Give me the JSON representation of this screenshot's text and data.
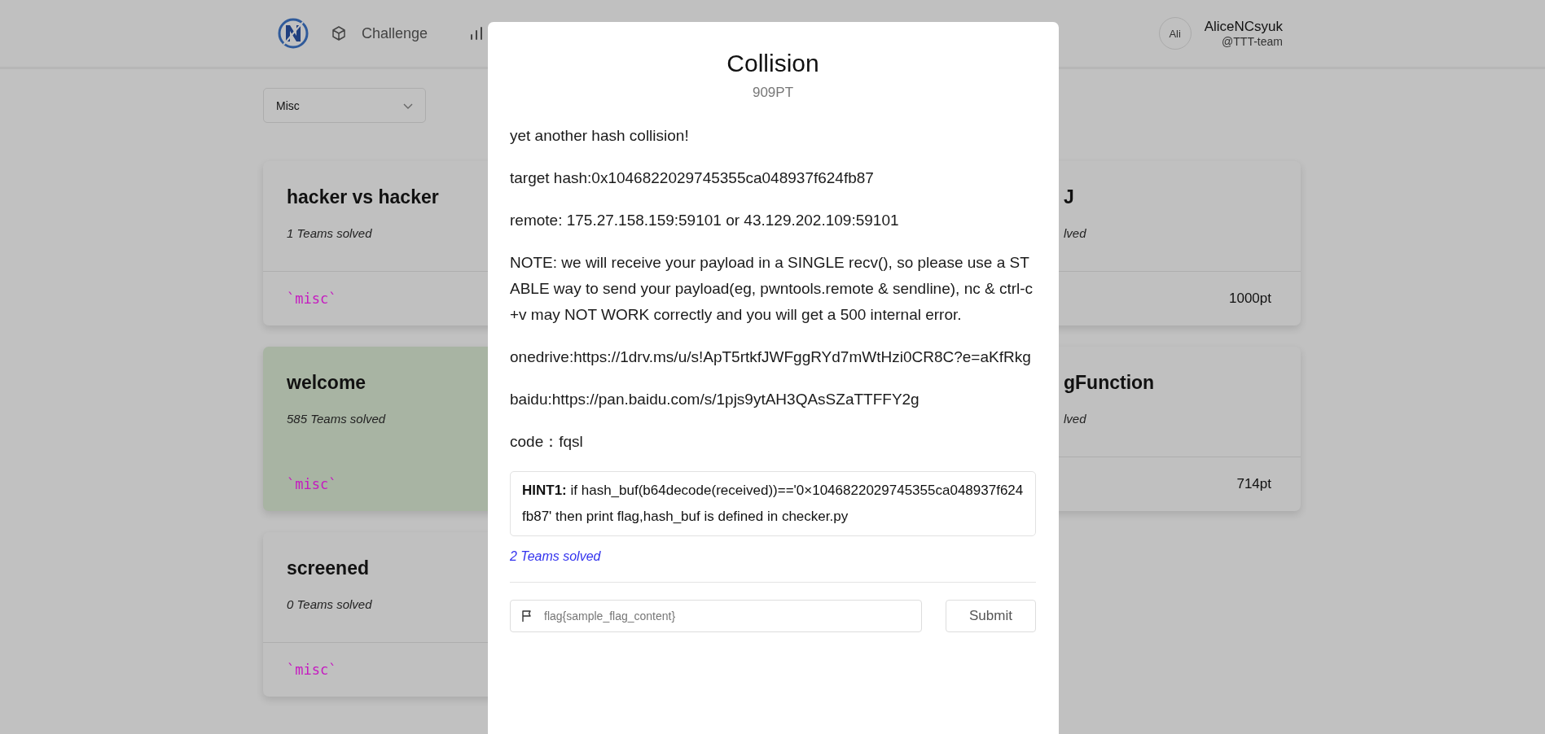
{
  "header": {
    "nav_items": [
      {
        "kind": "cube",
        "label": "Challenge"
      },
      {
        "kind": "bars"
      }
    ],
    "user": {
      "avatar": "Ali",
      "name": "AliceNCsyuk",
      "team": "@TTT-team"
    }
  },
  "category_filter": {
    "value": "Misc"
  },
  "cards_left": [
    {
      "title": "hacker vs hacker",
      "solved_text": "1 Teams solved",
      "tag": "`misc`",
      "solved": false
    },
    {
      "title": "welcome",
      "solved_text": "585 Teams solved",
      "tag": "`misc`",
      "solved": true
    },
    {
      "title": "screened",
      "solved_text": "0 Teams solved",
      "tag": "`misc`",
      "solved": false
    }
  ],
  "cards_right": [
    {
      "title": "J",
      "solved_text": "lved",
      "points": "1000pt",
      "solved": false
    },
    {
      "title": "gFunction",
      "solved_text": "lved",
      "points": "714pt",
      "solved": false
    }
  ],
  "modal": {
    "title": "Collision",
    "points": "909PT",
    "paragraphs": [
      "yet another hash collision!",
      "target hash:0x1046822029745355ca048937f624fb87",
      "remote: 175.27.158.159:59101 or 43.129.202.109:59101",
      "NOTE: we will receive your payload in a SINGLE recv(), so please use a STABLE way to send your payload(eg, pwntools.remote & sendline), nc & ctrl-c+v may NOT WORK correctly and you will get a 500 internal error.",
      "onedrive:https://1drv.ms/u/s!ApT5rtkfJWFggRYd7mWtHzi0CR8C?e=aKfRkg",
      "baidu:https://pan.baidu.com/s/1pjs9ytAH3QAsSZaTTFFY2g",
      "code：fqsl"
    ],
    "hint": "**HINT1:** if hash_buf(b64decode(received))=='0×1046822029745355ca048937f624fb87' then print flag,hash_buf is defined in checker.py",
    "solved_text": "2 Teams solved",
    "flag_input": {
      "placeholder": "flag{sample_flag_content}"
    },
    "submit": "Submit"
  }
}
